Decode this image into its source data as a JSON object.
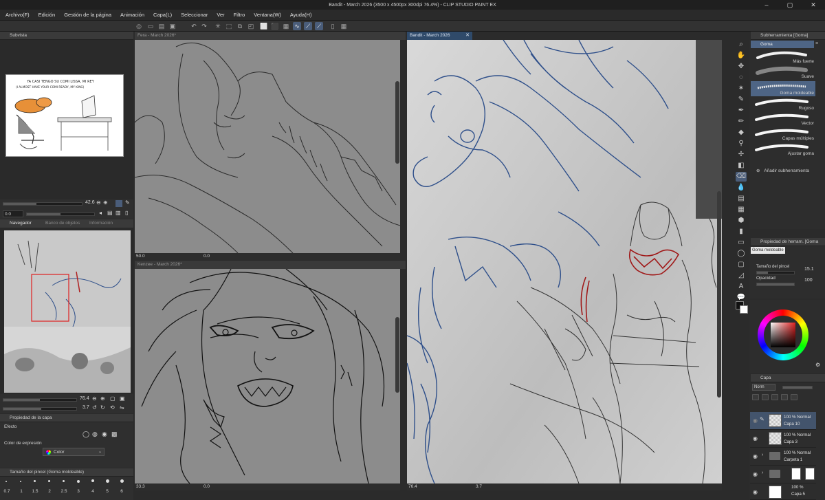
{
  "window": {
    "title": "Bandit - March 2026 (3500 x 4500px 300dpi 76.4%) - CLIP STUDIO PAINT EX"
  },
  "menu": [
    "Archivo(F)",
    "Edición",
    "Gestión de la página",
    "Animación",
    "Capa(L)",
    "Seleccionar",
    "Ver",
    "Filtro",
    "Ventana(W)",
    "Ayuda(H)"
  ],
  "subview": {
    "title": "Subvista",
    "comic_line1": "YA CASI TENGO SU COMI LISSA, MI REY",
    "comic_line2": "(I ALMOST HAVE YOUR COMI READY, MY KING)",
    "zoom": "42.6",
    "angle": "0.0"
  },
  "navigator": {
    "tabs": [
      "Navegador",
      "Banco de objetos",
      "Información"
    ],
    "zoom": "76.4",
    "angle": "3.7"
  },
  "layer_property": {
    "title": "Propiedad de la capa",
    "effect_label": "Efecto",
    "expression_label": "Color de expresión",
    "expression_value": "Color"
  },
  "brush_size_panel": {
    "title": "Tamaño del pincel (Goma moldeable)",
    "sizes": [
      "0.7",
      "1",
      "1.5",
      "2",
      "2.5",
      "3",
      "4",
      "5",
      "6"
    ]
  },
  "canvases": {
    "fera": {
      "tab": "Fera - March 2026*",
      "zoom": "50.0",
      "angle": "0.0"
    },
    "kenzee": {
      "tab": "Kenzee - March 2026*",
      "zoom": "33.3",
      "angle": "0.0"
    },
    "bandit": {
      "tab": "Bandit - March 2026",
      "zoom": "76.4",
      "angle": "3.7"
    }
  },
  "sub_tool": {
    "title": "Subherramienta [Goma]",
    "group": "Goma",
    "items": [
      "Más fuerte",
      "Suave",
      "Goma moldeable",
      "Rugoso",
      "Vector",
      "Capas múltiples",
      "Ajustar goma"
    ],
    "selected": "Goma moldeable",
    "add_label": "Añadir subherramienta"
  },
  "tool_property": {
    "title": "Propiedad de herram. [Goma moldeable]",
    "tool_name": "Goma moldeable",
    "size_label": "Tamaño del pincel",
    "size_value": "15.1",
    "opacity_label": "Opacidad",
    "opacity_value": "100"
  },
  "layers": {
    "title": "Capa",
    "blend_placeholder": "Norm",
    "rows": [
      {
        "line1": "100 % Normal",
        "line2": "Capa 10",
        "selected": true
      },
      {
        "line1": "100 % Normal",
        "line2": "Capa 3",
        "selected": false
      },
      {
        "line1": "100 % Normal",
        "line2": "Carpeta 1",
        "selected": false
      },
      {
        "line1": "",
        "line2": "",
        "selected": false
      },
      {
        "line1": "100 %",
        "line2": "Capa 5",
        "selected": false
      }
    ]
  },
  "colors": {
    "accent": "#4a5d7a",
    "sketch_blue": "#2e4f8a",
    "sketch_red": "#a01818",
    "canvas_bg": "#858585"
  }
}
